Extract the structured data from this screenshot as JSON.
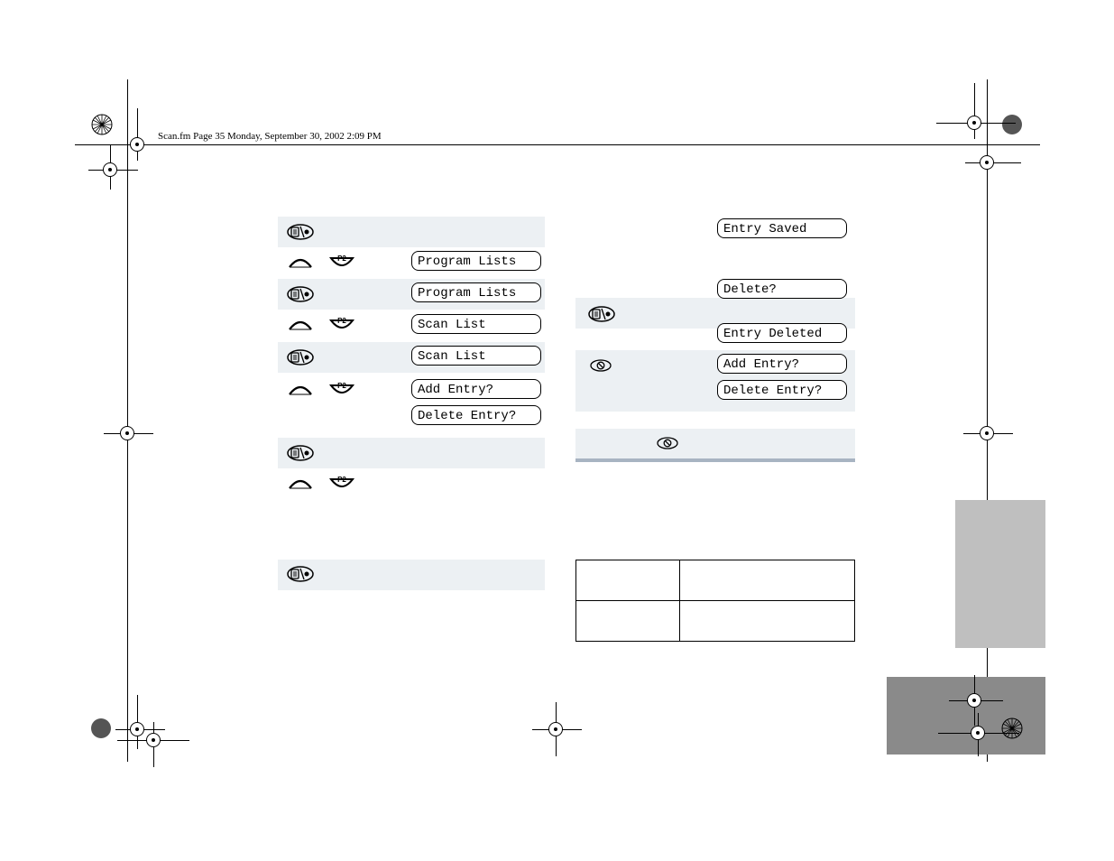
{
  "header": "Scan.fm  Page 35  Monday, September 30, 2002  2:09 PM",
  "left_lcd": {
    "r1": "Program Lists",
    "r2": "Program Lists",
    "r3": "Scan List",
    "r4": "Scan List",
    "r5": "Add Entry?",
    "r6": "Delete Entry?"
  },
  "right_lcd": {
    "r1": "Entry Saved",
    "r2": "Delete?",
    "r3": "Entry Deleted",
    "r4": "Add Entry?",
    "r5": "Delete Entry?"
  },
  "p2_label": "P2",
  "ref_table": {
    "a1": "",
    "a2": "",
    "b1": "",
    "b2": ""
  }
}
